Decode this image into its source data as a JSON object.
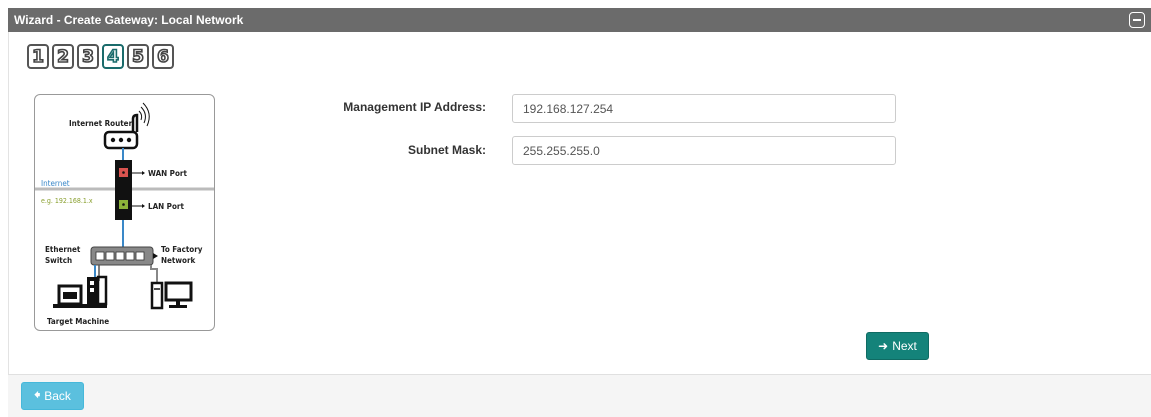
{
  "window": {
    "title": "Wizard - Create Gateway: Local Network"
  },
  "steps": [
    "1",
    "2",
    "3",
    "4",
    "5",
    "6"
  ],
  "current_step": "4",
  "diagram": {
    "internet_router": "Internet Router",
    "wan_port": "WAN Port",
    "internet": "Internet",
    "subnet_example": "e.g. 192.168.1.x",
    "lan_port": "LAN Port",
    "ethernet": "Ethernet",
    "switch": "Switch",
    "to_factory": "To Factory",
    "network": "Network",
    "target_machine": "Target Machine"
  },
  "form": {
    "management_ip": {
      "label": "Management IP Address:",
      "value": "192.168.127.254"
    },
    "subnet_mask": {
      "label": "Subnet Mask:",
      "value": "255.255.255.0"
    }
  },
  "buttons": {
    "next": "Next",
    "back": "Back"
  },
  "colors": {
    "accent": "#14837a",
    "back": "#5bc0de",
    "titlebar": "#6b6b6b"
  },
  "icons": {
    "next": "arrow-right-icon",
    "back": "arrow-left-icon",
    "collapse": "minus-square-icon"
  }
}
